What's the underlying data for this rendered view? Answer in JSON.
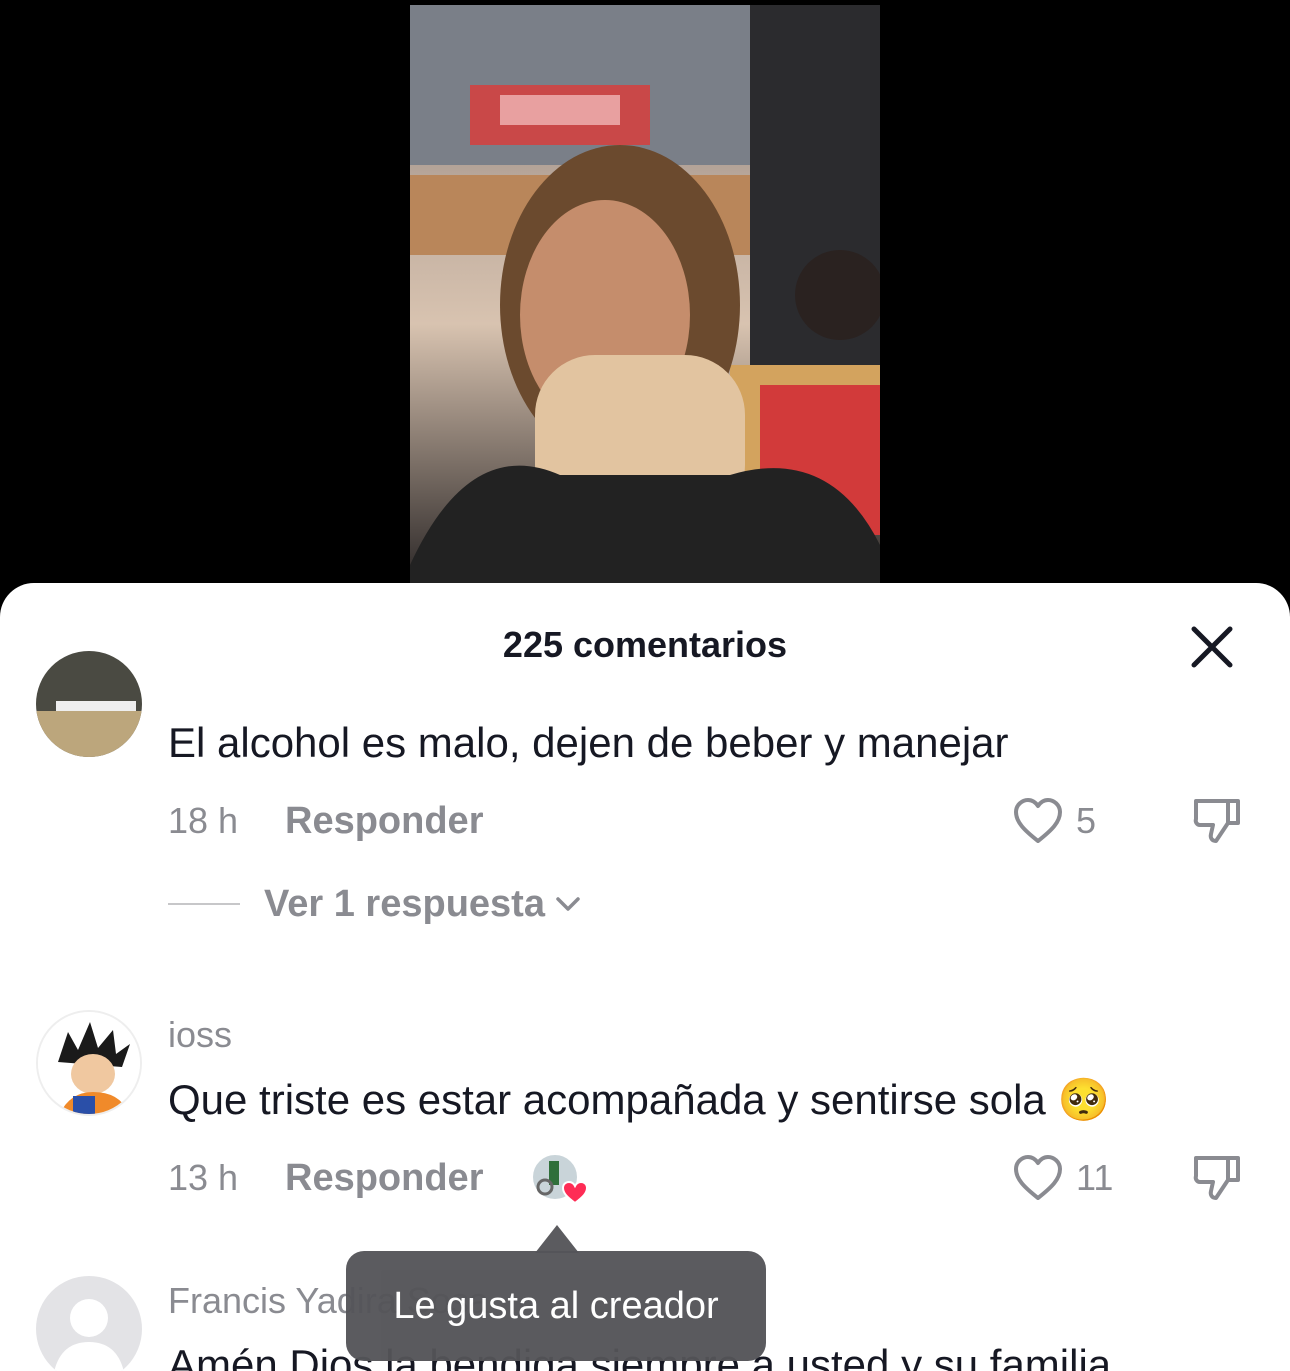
{
  "sheet": {
    "title": "225 comentarios"
  },
  "comments": [
    {
      "username": "",
      "text": "El alcohol es malo, dejen de beber y manejar",
      "time": "18 h",
      "reply_label": "Responder",
      "likes": "5",
      "replies_label": "Ver 1 respuesta"
    },
    {
      "username": "ioss",
      "text": "Que triste es estar acompañada y sentirse sola 🥺",
      "time": "13 h",
      "reply_label": "Responder",
      "likes": "11",
      "creator_liked": true
    },
    {
      "username": "Francis Yadira Sosa",
      "text": "Amén Dios la bendiga siempre a usted y su familia"
    }
  ],
  "tooltip": {
    "text": "Le gusta al creador"
  },
  "colors": {
    "sheet_bg": "#ffffff",
    "primary_text": "#161823",
    "secondary_text": "#8a8b91",
    "heart_red": "#fe2c55",
    "tooltip_bg": "#545458"
  },
  "icons": [
    "close-icon",
    "heart-outline-icon",
    "thumbs-down-icon",
    "chevron-down-icon",
    "creator-heart-icon"
  ]
}
